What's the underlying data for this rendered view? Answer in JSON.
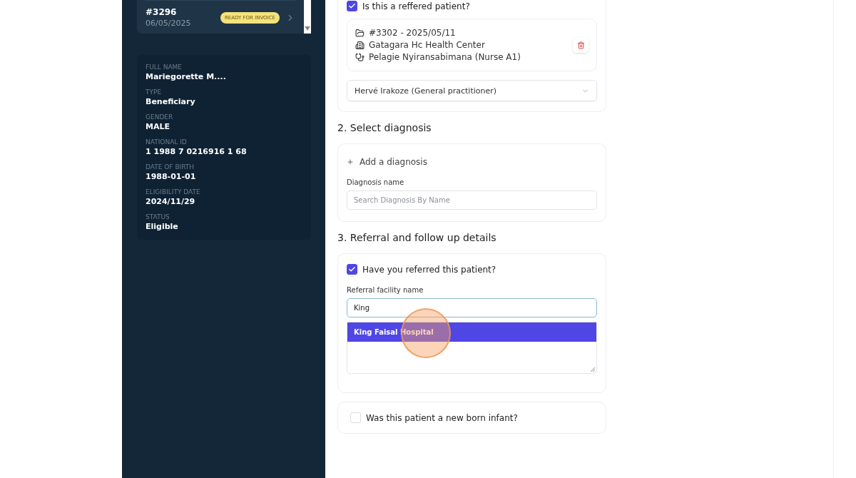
{
  "case_list": {
    "items": [
      {
        "number": "#3296",
        "date": "06/05/2025",
        "badge": "READY FOR INVOICE"
      }
    ]
  },
  "patient": {
    "fields": [
      {
        "label": "FULL NAME",
        "value": "Mariegorette M...."
      },
      {
        "label": "TYPE",
        "value": "Beneficiary"
      },
      {
        "label": "GENDER",
        "value": "MALE"
      },
      {
        "label": "NATIONAL ID",
        "value": "1 1988 7 0216916 1 68"
      },
      {
        "label": "DATE OF BIRTH",
        "value": "1988-01-01"
      },
      {
        "label": "ELIGIBILITY DATE",
        "value": "2024/11/29"
      },
      {
        "label": "STATUS",
        "value": "Eligible"
      }
    ]
  },
  "referred": {
    "label": "Is this a reffered patient?",
    "checked": true,
    "referral": {
      "case": "#3302 - 2025/05/11",
      "facility": "Gatagara Hc Health Center",
      "staff": "Pelagie Nyiransabimana (Nurse A1)"
    },
    "practitioner": "Hervé Irakoze (General practitioner)"
  },
  "diagnosis": {
    "heading": "2. Select diagnosis",
    "add_label": "Add a diagnosis",
    "field_label": "Diagnosis name",
    "placeholder": "Search Diagnosis By Name"
  },
  "referral_details": {
    "heading": "3. Referral and follow up details",
    "referred_label": "Have you referred this patient?",
    "referred_checked": true,
    "field_label": "Referral facility name",
    "value": "King",
    "options": [
      {
        "label": "King Faisal Hospital",
        "selected": true
      }
    ]
  },
  "newborn": {
    "label": "Was this patient a new born infant?",
    "checked": false
  }
}
